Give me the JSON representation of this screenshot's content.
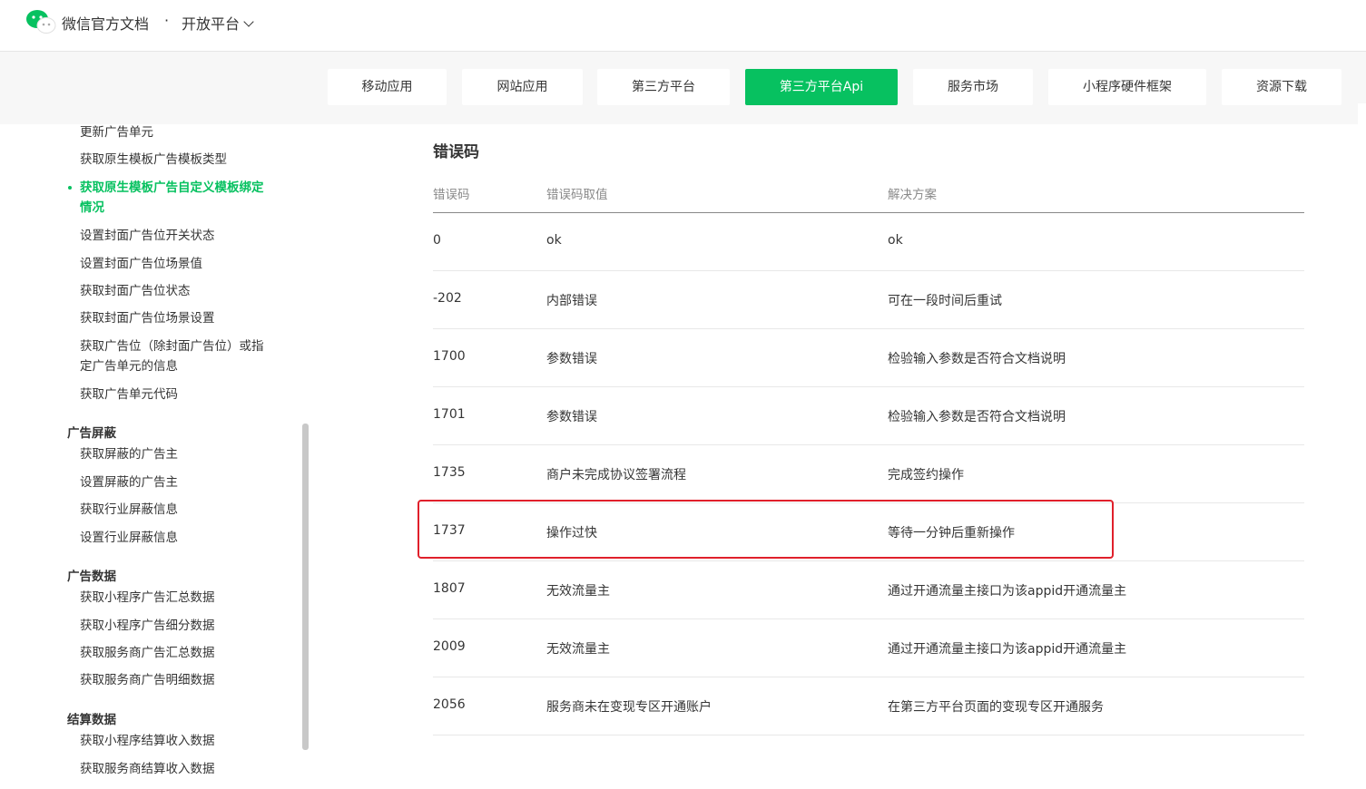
{
  "header": {
    "site_title": "微信官方文档",
    "separator": "·",
    "platform": "开放平台"
  },
  "nav": {
    "items": [
      {
        "label": "移动应用",
        "active": false
      },
      {
        "label": "网站应用",
        "active": false
      },
      {
        "label": "第三方平台",
        "active": false
      },
      {
        "label": "第三方平台Api",
        "active": true
      },
      {
        "label": "服务市场",
        "active": false
      },
      {
        "label": "小程序硬件框架",
        "active": false
      },
      {
        "label": "资源下载",
        "active": false
      }
    ]
  },
  "sidebar": {
    "items_top": [
      "更新广告单元",
      "获取原生模板广告模板类型",
      "获取原生模板广告自定义模板绑定情况",
      "设置封面广告位开关状态",
      "设置封面广告位场景值",
      "获取封面广告位状态",
      "获取封面广告位场景设置",
      "获取广告位（除封面广告位）或指定广告单元的信息",
      "获取广告单元代码"
    ],
    "active_item": "获取原生模板广告自定义模板绑定情况",
    "active_item_line1": "获取原生模板广告自定义模板绑定",
    "active_item_line2": "情况",
    "wrap_item_line1": "获取广告位（除封面广告位）或指",
    "wrap_item_line2": "定广告单元的信息",
    "groups": [
      {
        "title": "广告屏蔽",
        "items": [
          "获取屏蔽的广告主",
          "设置屏蔽的广告主",
          "获取行业屏蔽信息",
          "设置行业屏蔽信息"
        ]
      },
      {
        "title": "广告数据",
        "items": [
          "获取小程序广告汇总数据",
          "获取小程序广告细分数据",
          "获取服务商广告汇总数据",
          "获取服务商广告明细数据"
        ]
      },
      {
        "title": "结算数据",
        "items": [
          "获取小程序结算收入数据",
          "获取服务商结算收入数据"
        ]
      }
    ]
  },
  "content": {
    "section_title": "错误码",
    "table": {
      "headers": [
        "错误码",
        "错误码取值",
        "解决方案"
      ],
      "rows": [
        [
          "0",
          "ok",
          "ok"
        ],
        [
          "-202",
          "内部错误",
          "可在一段时间后重试"
        ],
        [
          "1700",
          "参数错误",
          "检验输入参数是否符合文档说明"
        ],
        [
          "1701",
          "参数错误",
          "检验输入参数是否符合文档说明"
        ],
        [
          "1735",
          "商户未完成协议签署流程",
          "完成签约操作"
        ],
        [
          "1737",
          "操作过快",
          "等待一分钟后重新操作"
        ],
        [
          "1807",
          "无效流量主",
          "通过开通流量主接口为该appid开通流量主"
        ],
        [
          "2009",
          "无效流量主",
          "通过开通流量主接口为该appid开通流量主"
        ],
        [
          "2056",
          "服务商未在变现专区开通账户",
          "在第三方平台页面的变现专区开通服务"
        ]
      ],
      "highlighted_code": "1737"
    }
  },
  "colors": {
    "accent": "#07c160",
    "highlight_border": "#e0202b",
    "text": "#353535",
    "muted": "#8a8a8a"
  },
  "icons": {
    "logo": "wechat-logo-icon",
    "dropdown": "chevron-down-icon"
  }
}
